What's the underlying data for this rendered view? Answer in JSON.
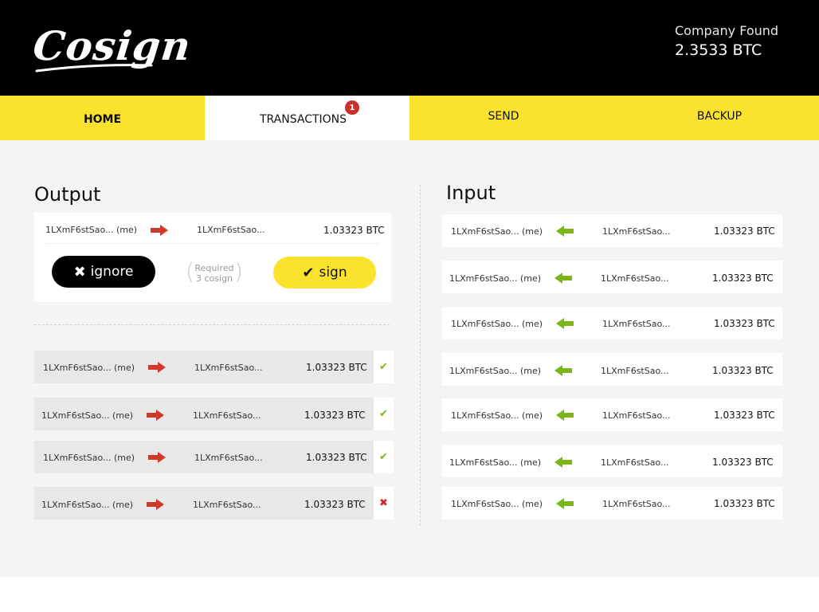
{
  "header": {
    "logo_text": "Cosign",
    "company_name": "Company Found",
    "company_balance": "2.3533 BTC"
  },
  "nav": {
    "tabs": [
      {
        "label": "HOME"
      },
      {
        "label": "TRANSACTIONS",
        "badge": "1"
      },
      {
        "label": "SEND"
      },
      {
        "label": "BACKUP"
      }
    ]
  },
  "output": {
    "title": "Output",
    "pending": {
      "from": "1LXmF6stSao... (me)",
      "to": "1LXmF6stSao...",
      "amount": "1.03323 BTC",
      "ignore_label": "ignore",
      "sign_label": "sign",
      "required_line1": "Required",
      "required_line2": "3 cosign"
    },
    "history": [
      {
        "from": "1LXmF6stSao... (me)",
        "to": "1LXmF6stSao...",
        "amount": "1.03323 BTC",
        "status": "✔",
        "status_type": "ok"
      },
      {
        "from": "1LXmF6stSao... (me)",
        "to": "1LXmF6stSao...",
        "amount": "1.03323 BTC",
        "status": "✔",
        "status_type": "ok"
      },
      {
        "from": "1LXmF6stSao... (me)",
        "to": "1LXmF6stSao...",
        "amount": "1.03323 BTC",
        "status": "✔",
        "status_type": "ok"
      },
      {
        "from": "1LXmF6stSao... (me)",
        "to": "1LXmF6stSao...",
        "amount": "1.03323 BTC",
        "status": "✖",
        "status_type": "fail"
      }
    ]
  },
  "input": {
    "title": "Input",
    "rows": [
      {
        "to": "1LXmF6stSao... (me)",
        "from": "1LXmF6stSao...",
        "amount": "1.03323 BTC"
      },
      {
        "to": "1LXmF6stSao... (me)",
        "from": "1LXmF6stSao...",
        "amount": "1.03323 BTC"
      },
      {
        "to": "1LXmF6stSao... (me)",
        "from": "1LXmF6stSao...",
        "amount": "1.03323 BTC"
      },
      {
        "to": "1LXmF6stSao... (me)",
        "from": "1LXmF6stSao...",
        "amount": "1.03323 BTC"
      },
      {
        "to": "1LXmF6stSao... (me)",
        "from": "1LXmF6stSao...",
        "amount": "1.03323 BTC"
      },
      {
        "to": "1LXmF6stSao... (me)",
        "from": "1LXmF6stSao...",
        "amount": "1.03323 BTC"
      },
      {
        "to": "1LXmF6stSao... (me)",
        "from": "1LXmF6stSao...",
        "amount": "1.03323 BTC"
      }
    ]
  },
  "colors": {
    "brand_yellow": "#fbe22d",
    "header_black": "#000000",
    "out_arrow": "#d0392b",
    "in_arrow": "#7cb518",
    "badge_red": "#c83028"
  },
  "icons": {
    "out_arrow": "arrow-right-icon",
    "in_arrow": "arrow-left-icon",
    "ignore": "close-icon",
    "sign": "checkmark-icon"
  }
}
